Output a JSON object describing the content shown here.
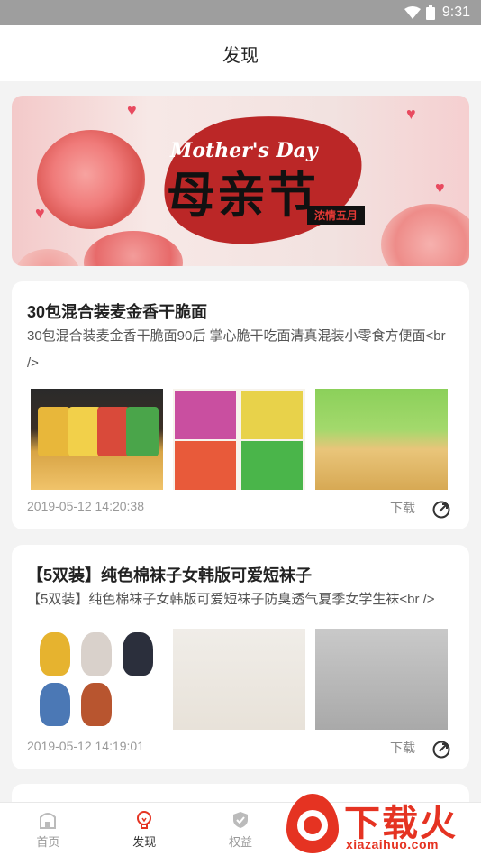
{
  "status": {
    "time": "9:31"
  },
  "header": {
    "title": "发现"
  },
  "banner": {
    "en_text": "Mother's Day",
    "cn_text": "母亲节",
    "stamp": "浓情五月"
  },
  "posts": [
    {
      "title": "30包混合装麦金香干脆面",
      "desc": "30包混合装麦金香干脆面90后 掌心脆干吃面清真混装小零食方便面<br />",
      "date": "2019-05-12 14:20:38",
      "download": "下载"
    },
    {
      "title": "【5双装】纯色棉袜子女韩版可爱短袜子",
      "desc": "【5双装】纯色棉袜子女韩版可爱短袜子防臭透气夏季女学生袜<br />",
      "date": "2019-05-12 14:19:01",
      "download": "下载"
    }
  ],
  "tabs": [
    {
      "label": "首页",
      "icon": "home-icon"
    },
    {
      "label": "发现",
      "icon": "lightbulb-icon",
      "active": true
    },
    {
      "label": "权益",
      "icon": "shield-icon"
    }
  ],
  "watermark": {
    "word": "下载火",
    "url": "xiazaihuo.com"
  },
  "colors": {
    "accent": "#e53322",
    "background": "#f3f3f3",
    "status_bar": "#9e9e9e"
  }
}
